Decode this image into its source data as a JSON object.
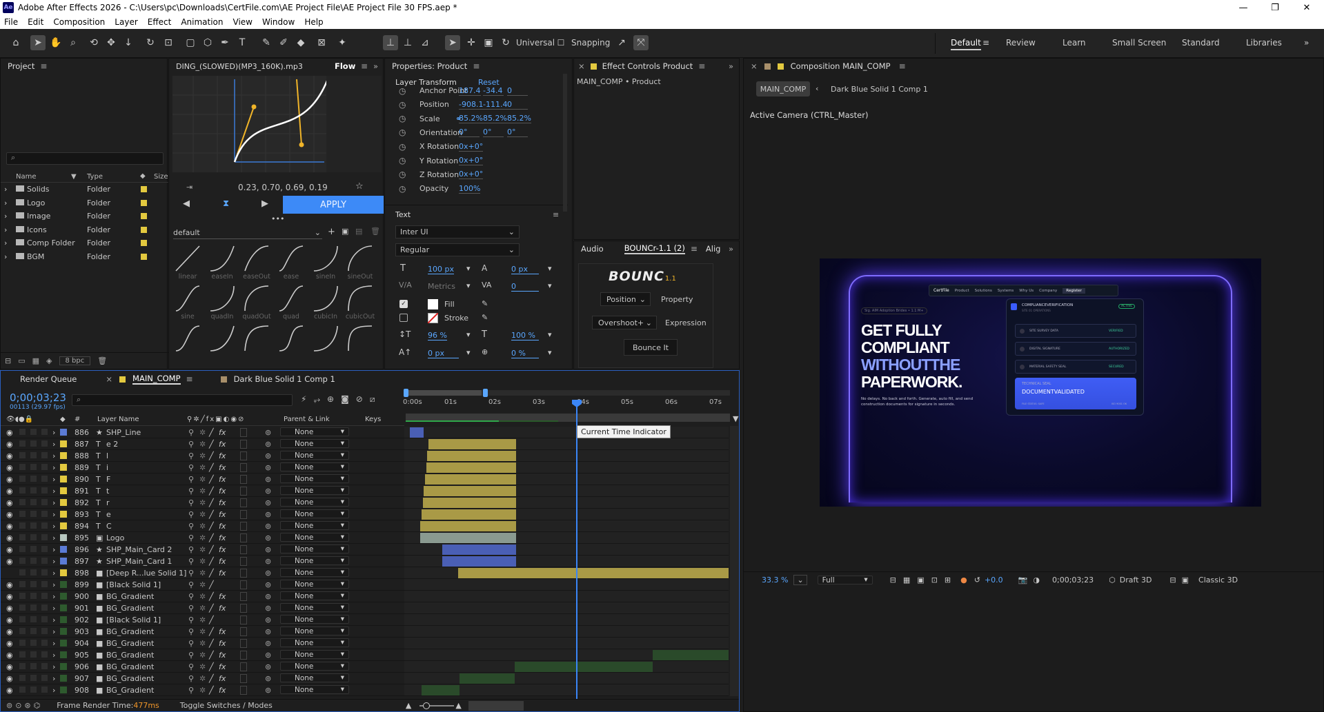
{
  "titlebar": {
    "app_icon": "Ae",
    "title": "Adobe After Effects 2026 - C:\\Users\\pc\\Downloads\\CertFile.com\\AE Project File\\AE Project File 30 FPS.aep *"
  },
  "menu": [
    "File",
    "Edit",
    "Composition",
    "Layer",
    "Effect",
    "Animation",
    "View",
    "Window",
    "Help"
  ],
  "toolbar": {
    "universal": "Universal",
    "snapping": "Snapping",
    "workspaces": [
      "Default",
      "Review",
      "Learn",
      "Small Screen",
      "Standard",
      "Libraries"
    ]
  },
  "project": {
    "title": "Project",
    "columns": {
      "name": "Name",
      "type": "Type",
      "size": "Size"
    },
    "items": [
      {
        "name": "Solids",
        "type": "Folder"
      },
      {
        "name": "Logo",
        "type": "Folder"
      },
      {
        "name": "Image",
        "type": "Folder"
      },
      {
        "name": "Icons",
        "type": "Folder"
      },
      {
        "name": "Comp Folder",
        "type": "Folder"
      },
      {
        "name": "BGM",
        "type": "Folder"
      }
    ],
    "bpc": "8 bpc"
  },
  "flow": {
    "file": "DING_(SLOWED)(MP3_160K).mp3",
    "title": "Flow",
    "values": "0.23, 0.70, 0.69, 0.19",
    "apply": "APPLY",
    "preset": "default",
    "curves": [
      "linear",
      "easeIn",
      "easeOut",
      "ease",
      "sineIn",
      "sineOut",
      "sine",
      "quadIn",
      "quadOut",
      "quad",
      "cubicIn",
      "cubicOut"
    ]
  },
  "properties": {
    "title": "Properties: Product",
    "section": "Layer Transform",
    "reset": "Reset",
    "rows": [
      {
        "label": "Anchor Point",
        "v": [
          "187.4",
          "-34.4",
          "0"
        ]
      },
      {
        "label": "Position",
        "v": [
          "-908.1",
          "-111.4",
          "0"
        ]
      },
      {
        "label": "Scale",
        "v": [
          "85.2%",
          "85.2%",
          "85.2%"
        ]
      },
      {
        "label": "Orientation",
        "v": [
          "0°",
          "0°",
          "0°"
        ]
      },
      {
        "label": "X Rotation",
        "v": [
          "0x+0°"
        ]
      },
      {
        "label": "Y Rotation",
        "v": [
          "0x+0°"
        ]
      },
      {
        "label": "Z Rotation",
        "v": [
          "0x+0°"
        ]
      },
      {
        "label": "Opacity",
        "v": [
          "100%"
        ]
      }
    ],
    "text_section": "Text",
    "font": "Inter UI",
    "style": "Regular",
    "font_size": "100 px",
    "tracking": "0 px",
    "metrics": "Metrics",
    "kerning": "0",
    "fill": "Fill",
    "stroke": "Stroke",
    "leading": "96 %",
    "vscale": "100 %",
    "baseline": "0 px",
    "tsume": "0 %"
  },
  "effect_controls": {
    "title": "Effect Controls Product",
    "subtitle": "MAIN_COMP • Product"
  },
  "bounce": {
    "tabs": [
      "Audio",
      "BOUNCr-1.1 (2)",
      "Alig"
    ],
    "logo": "BOUNC",
    "version": "1.1",
    "position": "Position",
    "property": "Property",
    "overshoot": "Overshoot+",
    "expression": "Expression",
    "button": "Bounce It"
  },
  "composition": {
    "title": "Composition MAIN_COMP",
    "crumb1": "MAIN_COMP",
    "crumb2": "Dark Blue Solid 1 Comp 1",
    "camera": "Active Camera (CTRL_Master)",
    "zoom": "33.3 %",
    "quality": "Full",
    "exposure": "+0.0",
    "time": "0;00;03;23",
    "renderer": "Draft 3D",
    "mode": "Classic 3D"
  },
  "web": {
    "nav": [
      "CertFile",
      "Product",
      "Solutions",
      "Systems",
      "Why Us",
      "Company",
      "Register"
    ],
    "badge": "Sig. AIM Adoption Brides • 1.1 M+",
    "h1a": "GET FULLY",
    "h1b": "COMPLIANT",
    "h1c": "WITHOUTTHE",
    "h1d": "PAPERWORK.",
    "sub": "No delays. No back and forth. Generate, auto fill, and send construction documents for signature in seconds.",
    "card_title": "COMPLIANCEVERIFICATION",
    "card_sub": "SITE 01 OPERATIONS",
    "active": "ACTIVE",
    "items": [
      {
        "l": "SITE SURVEY DATA",
        "s": "VERIFIED"
      },
      {
        "l": "DIGITAL SIGNATURE",
        "s": "AUTHORIZED"
      },
      {
        "l": "MATERIAL SAFETY SEAL",
        "s": "SECURED"
      }
    ],
    "seal_small": "TECHNICAL SEAL",
    "seal": "DOCUMENTVALIDATED",
    "seal_l": "FILE STATUS: SAFE",
    "seal_r": "ISO 9001 OK"
  },
  "timeline": {
    "tabs": [
      "Render Queue",
      "MAIN_COMP",
      "Dark Blue Solid 1 Comp 1"
    ],
    "time": "0;00;03;23",
    "fps": "00113 (29.97 fps)",
    "cols": {
      "num": "#",
      "name": "Layer Name",
      "parent": "Parent & Link",
      "keys": "Keys"
    },
    "ruler": [
      "0:00s",
      "01s",
      "02s",
      "03s",
      "04s",
      "05s",
      "06s",
      "07s"
    ],
    "tooltip": "Current Time Indicator",
    "footer_a": "Frame Render Time: ",
    "footer_ms": "477ms",
    "footer_b": "Toggle Switches / Modes",
    "layers": [
      {
        "n": "886",
        "c": "#5b7bd5",
        "t": "★",
        "name": "SHP_Line"
      },
      {
        "n": "887",
        "c": "#e3c93f",
        "t": "T",
        "name": "e 2"
      },
      {
        "n": "888",
        "c": "#e3c93f",
        "t": "T",
        "name": "l"
      },
      {
        "n": "889",
        "c": "#e3c93f",
        "t": "T",
        "name": "i"
      },
      {
        "n": "890",
        "c": "#e3c93f",
        "t": "T",
        "name": "F"
      },
      {
        "n": "891",
        "c": "#e3c93f",
        "t": "T",
        "name": "t"
      },
      {
        "n": "892",
        "c": "#e3c93f",
        "t": "T",
        "name": "r"
      },
      {
        "n": "893",
        "c": "#e3c93f",
        "t": "T",
        "name": "e"
      },
      {
        "n": "894",
        "c": "#e3c93f",
        "t": "T",
        "name": "C"
      },
      {
        "n": "895",
        "c": "#b8c8c0",
        "t": "▣",
        "name": "Logo"
      },
      {
        "n": "896",
        "c": "#5b7bd5",
        "t": "★",
        "name": "SHP_Main_Card 2"
      },
      {
        "n": "897",
        "c": "#5b7bd5",
        "t": "★",
        "name": "SHP_Main_Card 1"
      },
      {
        "n": "898",
        "c": "#e3c93f",
        "t": "■",
        "name": "[Deep R...lue Solid 1]"
      },
      {
        "n": "899",
        "c": "#2e5a2e",
        "t": "■",
        "name": "[Black Solid 1]"
      },
      {
        "n": "900",
        "c": "#2e5a2e",
        "t": "■",
        "name": "BG_Gradient"
      },
      {
        "n": "901",
        "c": "#2e5a2e",
        "t": "■",
        "name": "BG_Gradient"
      },
      {
        "n": "902",
        "c": "#2e5a2e",
        "t": "■",
        "name": "[Black Solid 1]"
      },
      {
        "n": "903",
        "c": "#2e5a2e",
        "t": "■",
        "name": "BG_Gradient"
      },
      {
        "n": "904",
        "c": "#2e5a2e",
        "t": "■",
        "name": "BG_Gradient"
      },
      {
        "n": "905",
        "c": "#2e5a2e",
        "t": "■",
        "name": "BG_Gradient"
      },
      {
        "n": "906",
        "c": "#2e5a2e",
        "t": "■",
        "name": "BG_Gradient"
      },
      {
        "n": "907",
        "c": "#2e5a2e",
        "t": "■",
        "name": "BG_Gradient"
      },
      {
        "n": "908",
        "c": "#2e5a2e",
        "t": "■",
        "name": "BG_Gradient"
      }
    ],
    "parent": "None"
  }
}
